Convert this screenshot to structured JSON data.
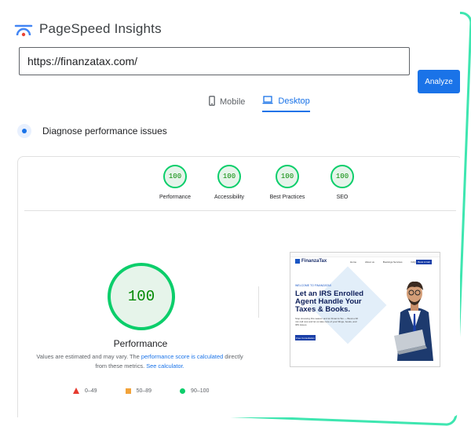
{
  "app": {
    "title": "PageSpeed Insights",
    "logo_icon": "pagespeed-logo-icon"
  },
  "search": {
    "url": "https://finanzatax.com/",
    "analyze_label": "Analyze"
  },
  "tabs": [
    {
      "label": "Mobile",
      "icon": "phone-icon",
      "active": false
    },
    {
      "label": "Desktop",
      "icon": "laptop-icon",
      "active": true
    }
  ],
  "diagnose": {
    "title": "Diagnose performance issues"
  },
  "scores": [
    {
      "value": "100",
      "label": "Performance"
    },
    {
      "value": "100",
      "label": "Accessibility"
    },
    {
      "value": "100",
      "label": "Best Practices"
    },
    {
      "value": "100",
      "label": "SEO"
    }
  ],
  "performance": {
    "score": "100",
    "title": "Performance",
    "note_prefix": "Values are estimated and may vary. The ",
    "note_link1": "performance score is calculated",
    "note_middle": " directly from these metrics. ",
    "note_link2": "See calculator."
  },
  "legend": [
    {
      "label": "0–49",
      "color": "#e63a2e",
      "shape": "triangle"
    },
    {
      "label": "50–89",
      "color": "#f2a33a",
      "shape": "square"
    },
    {
      "label": "90–100",
      "color": "#0cce6b",
      "shape": "circle"
    }
  ],
  "screenshot": {
    "brand": "FinanzaTax",
    "nav": [
      "Home",
      "About us",
      "Bookings Services",
      "FAQ",
      "Pay Your Invoice"
    ],
    "cta": "Book A Call",
    "eyebrow": "WELCOME TO FINANZATAX",
    "headline": "Let an IRS Enrolled Agent Handle Your Taxes & Books.",
    "paragraph": "Stop stressing this season and let Finanza Tax — Book a 30 min call now and let us take care of your filings, books, and IRS issues.",
    "button": "Free Consultation"
  },
  "colors": {
    "accent": "#1a73e8",
    "pass": "#0cce6b",
    "frame": "#3ee6b0"
  }
}
